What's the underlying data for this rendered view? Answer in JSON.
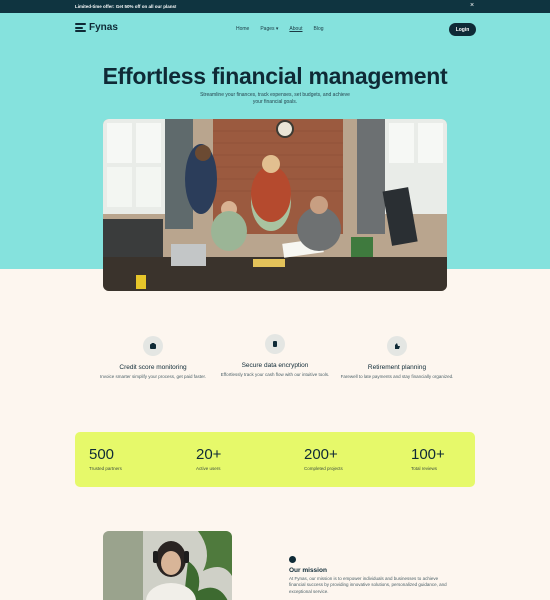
{
  "announcement": {
    "text": "Limited-time offer: Get 50% off on all our plans!",
    "close": "×"
  },
  "brand": {
    "name": "Fynas"
  },
  "nav": {
    "items": [
      "Home",
      "Pages ▾",
      "About",
      "Blog"
    ]
  },
  "header": {
    "login": "Login"
  },
  "hero": {
    "title": "Effortless financial management",
    "subtitle": "Streamline your finances, track expenses, set budgets, and achieve your financial goals."
  },
  "features": [
    {
      "icon": "piggy-bank-icon",
      "title": "Credit score monitoring",
      "text": "Invoice smarter simplify your process, get paid faster."
    },
    {
      "icon": "lock-icon",
      "title": "Secure data encryption",
      "text": "Effortlessly track your cash flow with our intuitive tools."
    },
    {
      "icon": "hand-icon",
      "title": "Retirement planning",
      "text": "Farewell to late payments and stay financially organized."
    }
  ],
  "stats": [
    {
      "value": "500",
      "label": "Trusted partners"
    },
    {
      "value": "20+",
      "label": "Active users"
    },
    {
      "value": "200+",
      "label": "Completed projects"
    },
    {
      "value": "100+",
      "label": "Total reviews"
    }
  ],
  "mission": {
    "title": "Our mission",
    "text": "At Fynas, our mission is to empower individuals and businesses to achieve financial success by providing innovative solutions, personalized guidance, and exceptional service."
  },
  "colors": {
    "hero_bg": "#85e2dd",
    "page_bg": "#fdf6ef",
    "dark": "#0f2a36",
    "stats_bg": "#e6f96a"
  }
}
